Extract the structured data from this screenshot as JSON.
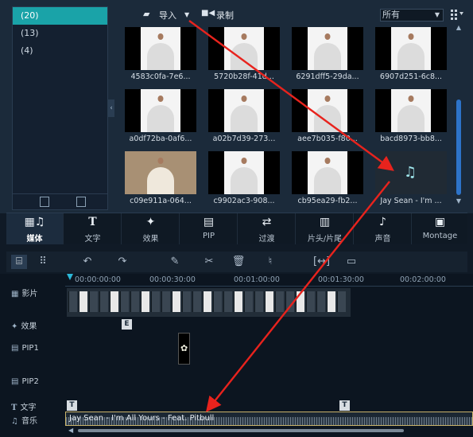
{
  "folders": {
    "items": [
      {
        "label": "(20)"
      },
      {
        "label": "(13)"
      },
      {
        "label": "(4)"
      }
    ]
  },
  "libbar": {
    "import_label": "导入",
    "record_label": "录制",
    "filter_value": "所有"
  },
  "media": {
    "tiles": [
      {
        "label": "4583c0fa-7e6..."
      },
      {
        "label": "5720b28f-41d..."
      },
      {
        "label": "6291dff5-29da..."
      },
      {
        "label": "6907d251-6c8..."
      },
      {
        "label": "a0df72ba-0af6..."
      },
      {
        "label": "a02b7d39-273..."
      },
      {
        "label": "aee7b035-f80..."
      },
      {
        "label": "bacd8973-bb8..."
      },
      {
        "label": "c09e911a-064..."
      },
      {
        "label": "c9902ac3-908..."
      },
      {
        "label": "cb95ea29-fb2..."
      },
      {
        "label": "Jay Sean - I'm ..."
      }
    ]
  },
  "tabs": [
    {
      "label": "媒体",
      "icon": "media-icon"
    },
    {
      "label": "文字",
      "icon": "text-icon"
    },
    {
      "label": "效果",
      "icon": "effects-icon"
    },
    {
      "label": "PIP",
      "icon": "pip-icon"
    },
    {
      "label": "过渡",
      "icon": "transition-icon"
    },
    {
      "label": "片头/片尾",
      "icon": "intro-outro-icon"
    },
    {
      "label": "声音",
      "icon": "audio-icon"
    },
    {
      "label": "Montage",
      "icon": "montage-icon"
    }
  ],
  "timeline": {
    "ruler": [
      {
        "label": "00:00:00:00"
      },
      {
        "label": "00:00:30:00"
      },
      {
        "label": "00:01:00:00"
      },
      {
        "label": "00:01:30:00"
      },
      {
        "label": "00:02:00:00"
      }
    ],
    "tracks": [
      {
        "label": "影片"
      },
      {
        "label": "效果"
      },
      {
        "label": "PIP1"
      },
      {
        "label": "PIP2"
      },
      {
        "label": "文字"
      },
      {
        "label": "音乐"
      }
    ],
    "effect_marker": "E",
    "title_marker": "T",
    "audio_clip_label": "Jay Sean - I'm All Yours - Feat. Pitbull"
  },
  "colors": {
    "accent": "#1aa3a8",
    "arrow": "#e8231d",
    "audio_border": "#c9b36a"
  }
}
